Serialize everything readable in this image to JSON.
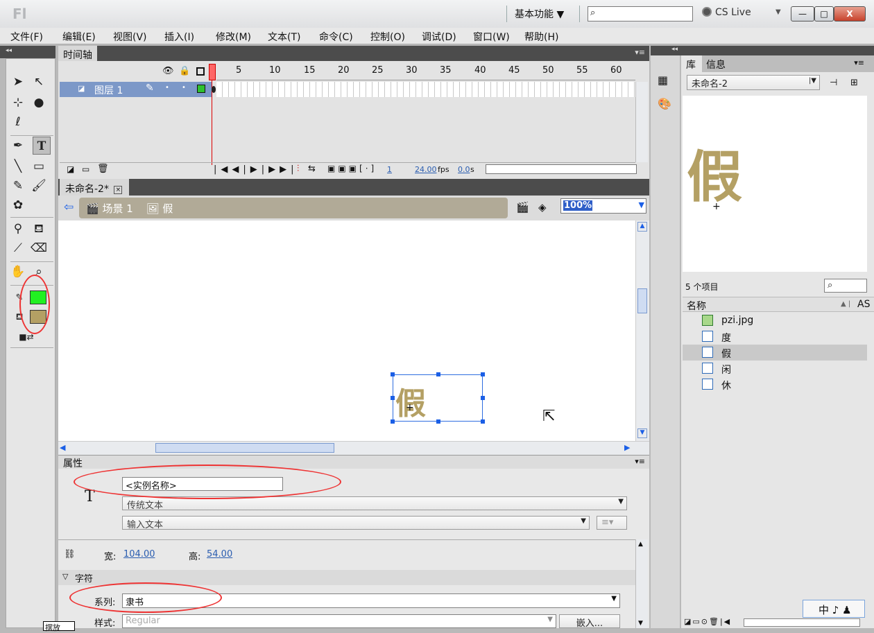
{
  "app": {
    "logo": "Fl",
    "workspace": "基本功能 ▼",
    "cs_live": "CS Live"
  },
  "window_buttons": {
    "minimize": "—",
    "maximize": "□",
    "close": "X"
  },
  "menu": [
    "文件(F)",
    "编辑(E)",
    "视图(V)",
    "插入(I)",
    "修改(M)",
    "文本(T)",
    "命令(C)",
    "控制(O)",
    "调试(D)",
    "窗口(W)",
    "帮助(H)"
  ],
  "timeline": {
    "tab": "时间轴",
    "layer_name": "图层 1",
    "ruler": [
      "5",
      "10",
      "15",
      "20",
      "25",
      "30",
      "35",
      "40",
      "45",
      "50",
      "55",
      "60"
    ],
    "current_frame": "1",
    "fps": "24.00",
    "fps_unit": "fps",
    "time": "0.0",
    "time_unit": "s"
  },
  "document": {
    "tab": "未命名-2*",
    "scene": "场景 1",
    "symbol": "假",
    "zoom": "100%"
  },
  "stage": {
    "symbol_char": "假"
  },
  "properties": {
    "title": "属性",
    "instance_name": "<实例名称>",
    "text_engine": "传统文本",
    "text_type": "输入文本",
    "width_label": "宽:",
    "width": "104.00",
    "height_label": "高:",
    "height": "54.00",
    "char_section": "字符",
    "family_label": "系列:",
    "family": "隶书",
    "style_label": "样式:",
    "style": "Regular",
    "embed": "嵌入..."
  },
  "library": {
    "tabs": [
      "库",
      "信息"
    ],
    "doc": "未命名-2",
    "preview_char": "假",
    "count": "5 个项目",
    "col_name": "名称",
    "col_as": "AS",
    "items": [
      "pzi.jpg",
      "度",
      "假",
      "闲",
      "休"
    ],
    "selected": "假"
  },
  "ime": "中 ♪ ♟",
  "tooltip": "摆放"
}
